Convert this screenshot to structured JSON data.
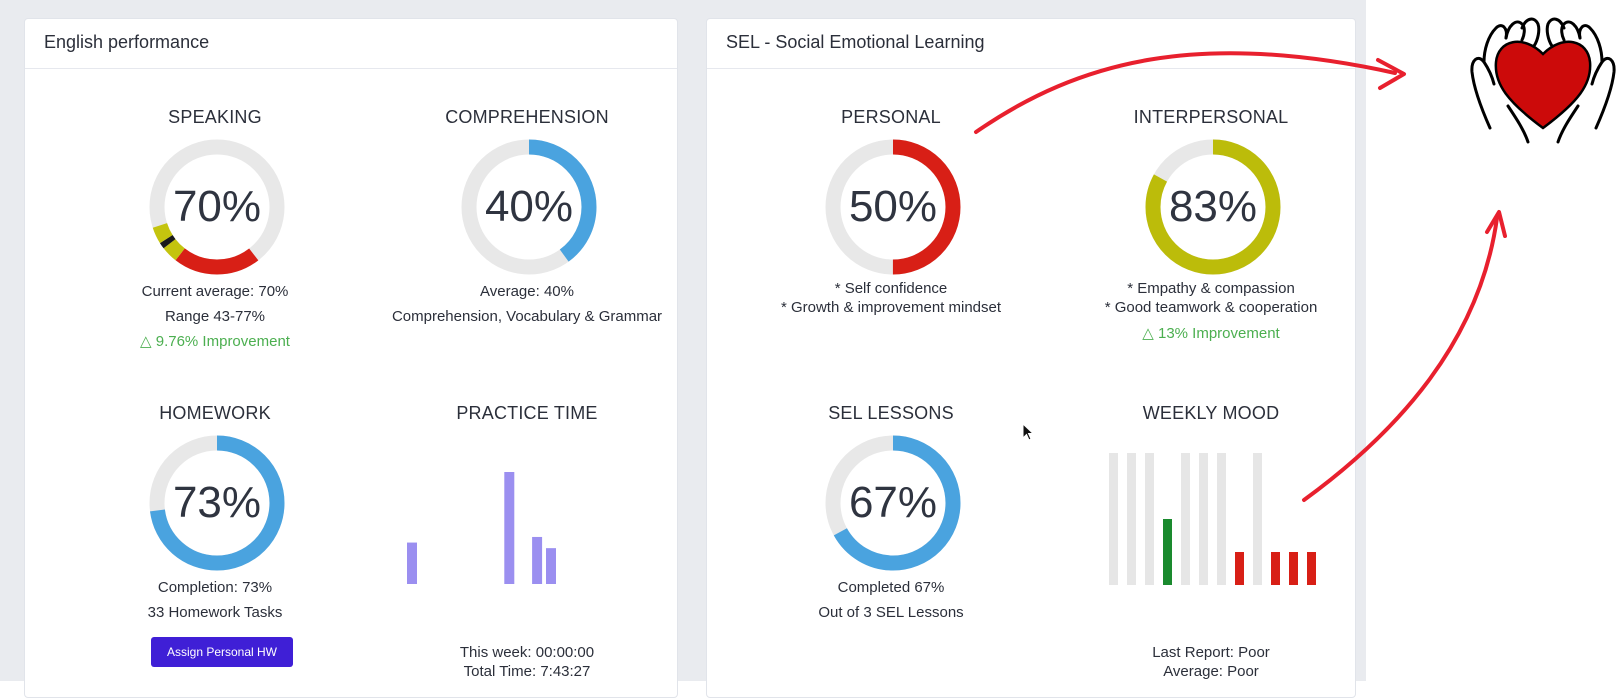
{
  "english": {
    "header": "English performance",
    "speaking": {
      "title": "SPEAKING",
      "percent_label": "70%",
      "value": 70,
      "segments": [
        {
          "value": 0.21,
          "color": "#d81f16"
        },
        {
          "value": 0.04,
          "color": "#c4c40e"
        },
        {
          "value": 0.015,
          "color": "#1a1a1a"
        },
        {
          "value": 0.04,
          "color": "#c4c40e"
        }
      ],
      "line1": "Current average: 70%",
      "line2": "Range 43-77%",
      "improvement": "△  9.76% Improvement"
    },
    "comprehension": {
      "title": "COMPREHENSION",
      "percent_label": "40%",
      "value": 40,
      "color": "#4aa3df",
      "line1": "Average: 40%",
      "line2": "Comprehension, Vocabulary & Grammar"
    },
    "homework": {
      "title": "HOMEWORK",
      "percent_label": "73%",
      "value": 73,
      "color": "#4aa3df",
      "line1": "Completion: 73%",
      "line2": "33 Homework Tasks",
      "button_label": "Assign Personal HW"
    },
    "practice": {
      "title": "PRACTICE TIME",
      "bars": [
        0.37,
        0,
        0,
        0,
        0,
        0,
        0,
        1.0,
        0,
        0.42,
        0.32
      ],
      "bar_color": "#9b8ff0",
      "line1": "This week: 00:00:00",
      "line2": "Total Time: 7:43:27"
    }
  },
  "sel": {
    "header": "SEL - Social Emotional Learning",
    "personal": {
      "title": "PERSONAL",
      "percent_label": "50%",
      "value": 50,
      "color": "#d81f16",
      "line1": "* Self confidence",
      "line2": "* Growth & improvement mindset"
    },
    "interpersonal": {
      "title": "INTERPERSONAL",
      "percent_label": "83%",
      "value": 83,
      "color": "#bcbc0a",
      "line1": "* Empathy & compassion",
      "line2": "* Good teamwork & cooperation",
      "improvement": "△  13% Improvement"
    },
    "lessons": {
      "title": "SEL LESSONS",
      "percent_label": "67%",
      "value": 67,
      "color": "#4aa3df",
      "line1": "Completed 67%",
      "line2": "Out of 3 SEL Lessons"
    },
    "mood": {
      "title": "WEEKLY MOOD",
      "bars": [
        {
          "level": 0,
          "color": null
        },
        {
          "level": 0,
          "color": null
        },
        {
          "level": 0,
          "color": null
        },
        {
          "level": 0.5,
          "color": "#1a8a2e"
        },
        {
          "level": 0,
          "color": null
        },
        {
          "level": 0,
          "color": null
        },
        {
          "level": 0,
          "color": null
        },
        {
          "level": 0.25,
          "color": "#d81f16"
        },
        {
          "level": 0,
          "color": null
        },
        {
          "level": 0.25,
          "color": "#d81f16"
        },
        {
          "level": 0.25,
          "color": "#d81f16"
        },
        {
          "level": 0.25,
          "color": "#d81f16"
        }
      ],
      "line1": "Last Report: Poor",
      "line2": "Average: Poor"
    }
  },
  "annotation": {
    "arrow_color": "#e8202e",
    "heart_color": "#cc0a0a"
  }
}
